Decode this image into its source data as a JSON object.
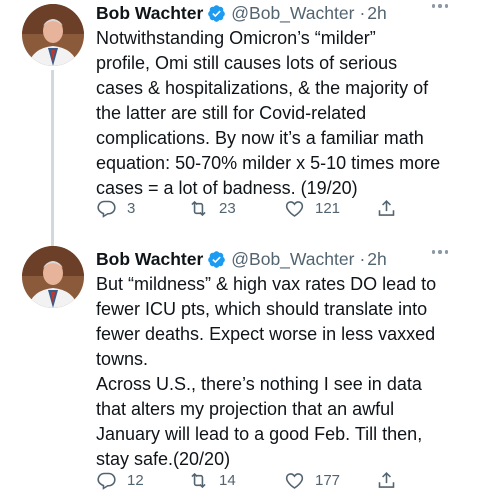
{
  "tweets": [
    {
      "name": "Bob Wachter",
      "handle": "@Bob_Wachter",
      "separator": "·",
      "time": "2h",
      "text": "Notwithstanding Omicron’s “milder”\nprofile, Omi still causes lots of serious\ncases & hospitalizations, & the majority of\nthe latter are still for Covid-related\ncomplications. By now it’s a familiar math\nequation: 50-70% milder x 5-10 times more\ncases = a lot of badness. (19/20)",
      "replies": "3",
      "retweets": "23",
      "likes": "121"
    },
    {
      "name": "Bob Wachter",
      "handle": "@Bob_Wachter",
      "separator": "·",
      "time": "2h",
      "text": "But “mildness” & high vax rates DO lead to\nfewer ICU pts, which should translate into\nfewer deaths. Expect worse in less vaxxed\ntowns.\nAcross U.S., there’s nothing I see in data\nthat alters my projection that an awful\nJanuary will lead to a good Feb. Till then,\nstay safe.(20/20)",
      "replies": "12",
      "retweets": "14",
      "likes": "177"
    }
  ],
  "colors": {
    "verified": "#1d9bf0",
    "muted": "#536471",
    "thread_line": "#cfd9de"
  },
  "icons": [
    "verified-badge-icon",
    "more-icon",
    "reply-icon",
    "retweet-icon",
    "like-icon",
    "share-icon"
  ]
}
